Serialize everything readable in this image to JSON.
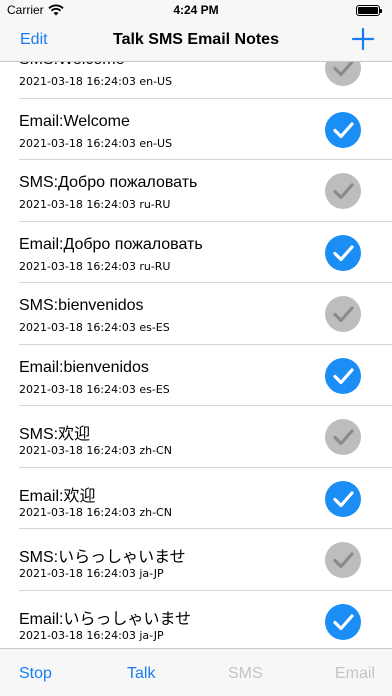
{
  "status_bar": {
    "carrier": "Carrier",
    "time": "4:24 PM"
  },
  "nav": {
    "edit_label": "Edit",
    "title": "Talk SMS Email Notes",
    "add_icon": "plus-icon"
  },
  "colors": {
    "accent": "#1a7cf5",
    "check_on": "#1a8ef5",
    "check_off": "#bdbdbd",
    "disabled": "#c4c4c4"
  },
  "rows": [
    {
      "title": "SMS:Welcome",
      "subtitle": "2021-03-18 16:24:03 en-US",
      "checked": false
    },
    {
      "title": "Email:Welcome",
      "subtitle": "2021-03-18 16:24:03 en-US",
      "checked": true
    },
    {
      "title": "SMS:Добро пожаловать",
      "subtitle": "2021-03-18 16:24:03 ru-RU",
      "checked": false
    },
    {
      "title": "Email:Добро пожаловать",
      "subtitle": "2021-03-18 16:24:03 ru-RU",
      "checked": true
    },
    {
      "title": "SMS:bienvenidos",
      "subtitle": "2021-03-18 16:24:03 es-ES",
      "checked": false
    },
    {
      "title": "Email:bienvenidos",
      "subtitle": "2021-03-18 16:24:03 es-ES",
      "checked": true
    },
    {
      "title": "SMS:欢迎",
      "subtitle": "2021-03-18 16:24:03 zh-CN",
      "checked": false
    },
    {
      "title": "Email:欢迎",
      "subtitle": "2021-03-18 16:24:03 zh-CN",
      "checked": true
    },
    {
      "title": "SMS:いらっしゃいませ",
      "subtitle": "2021-03-18 16:24:03 ja-JP",
      "checked": false
    },
    {
      "title": "Email:いらっしゃいませ",
      "subtitle": "2021-03-18 16:24:03 ja-JP",
      "checked": true
    }
  ],
  "toolbar": {
    "stop_label": "Stop",
    "talk_label": "Talk",
    "sms_label": "SMS",
    "email_label": "Email"
  }
}
